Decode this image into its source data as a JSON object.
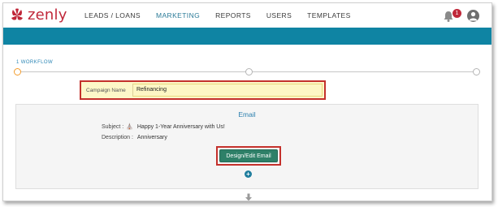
{
  "brand": {
    "name": "zenly",
    "color": "#c0283a",
    "accent": "#0f84a3"
  },
  "nav": {
    "items": [
      {
        "label": "LEADS / LOANS",
        "active": false
      },
      {
        "label": "MARKETING",
        "active": true
      },
      {
        "label": "REPORTS",
        "active": false
      },
      {
        "label": "USERS",
        "active": false
      },
      {
        "label": "TEMPLATES",
        "active": false
      }
    ]
  },
  "header": {
    "notifications_count": "1",
    "notification_icon": "bell-icon",
    "avatar_icon": "user-avatar-icon"
  },
  "workflow": {
    "label": "1 WORKFLOW",
    "steps": 3,
    "current_step": 1
  },
  "campaign": {
    "label": "Campaign Name",
    "value": "Refinancing"
  },
  "email": {
    "title": "Email",
    "subject_label": "Subject :",
    "subject_value": "Happy 1-Year Anniversary with Us!",
    "subject_icon": "gift-icon",
    "description_label": "Description :",
    "description_value": "Anniversary",
    "design_button": "Design/Edit Email",
    "add_icon": "plus-circle-icon",
    "next_icon": "arrow-down-icon"
  }
}
